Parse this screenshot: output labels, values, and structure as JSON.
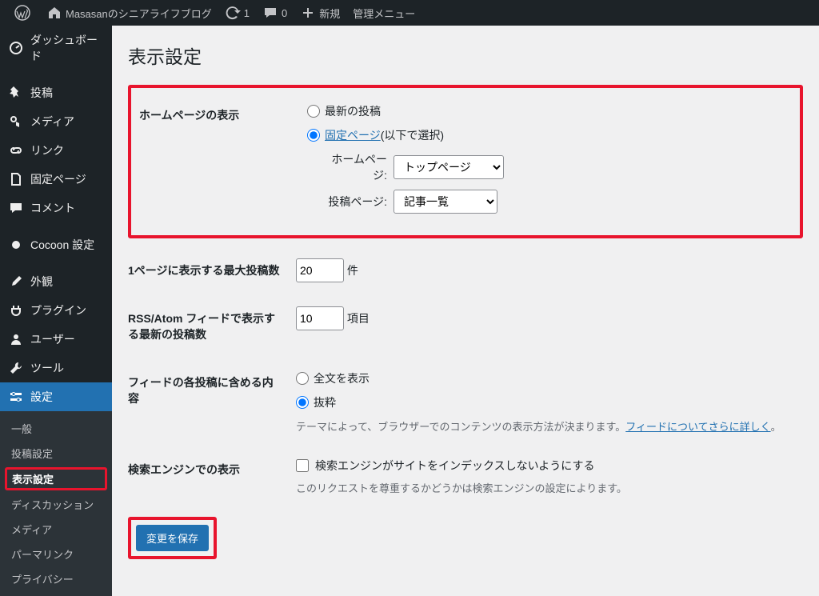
{
  "toolbar": {
    "site_name": "Masasanのシニアライフブログ",
    "updates": "1",
    "comments": "0",
    "new": "新規",
    "admin_menu": "管理メニュー"
  },
  "sidebar": {
    "items": [
      {
        "label": "ダッシュボード",
        "icon": "dashboard"
      },
      {
        "label": "投稿",
        "icon": "pin"
      },
      {
        "label": "メディア",
        "icon": "media"
      },
      {
        "label": "リンク",
        "icon": "link"
      },
      {
        "label": "固定ページ",
        "icon": "page"
      },
      {
        "label": "コメント",
        "icon": "comment"
      },
      {
        "label": "Cocoon 設定",
        "icon": "cocoon"
      },
      {
        "label": "外観",
        "icon": "brush"
      },
      {
        "label": "プラグイン",
        "icon": "plug"
      },
      {
        "label": "ユーザー",
        "icon": "user"
      },
      {
        "label": "ツール",
        "icon": "tool"
      },
      {
        "label": "設定",
        "icon": "settings"
      }
    ],
    "submenu": [
      {
        "label": "一般"
      },
      {
        "label": "投稿設定"
      },
      {
        "label": "表示設定",
        "active": true
      },
      {
        "label": "ディスカッション"
      },
      {
        "label": "メディア"
      },
      {
        "label": "パーマリンク"
      },
      {
        "label": "プライバシー"
      }
    ]
  },
  "page": {
    "title": "表示設定",
    "homepage": {
      "label": "ホームページの表示",
      "opt_latest": "最新の投稿",
      "opt_fixed_link": "固定ページ",
      "opt_fixed_suffix": " (以下で選択)",
      "home_label": "ホームページ:",
      "home_value": "トップページ",
      "posts_label": "投稿ページ:",
      "posts_value": "記事一覧"
    },
    "per_page": {
      "label": "1ページに表示する最大投稿数",
      "value": "20",
      "unit": "件"
    },
    "rss": {
      "label": "RSS/Atom フィードで表示する最新の投稿数",
      "value": "10",
      "unit": "項目"
    },
    "feed": {
      "label": "フィードの各投稿に含める内容",
      "opt_full": "全文を表示",
      "opt_excerpt": "抜粋",
      "note_prefix": "テーマによって、ブラウザーでのコンテンツの表示方法が決まります。",
      "note_link": "フィードについてさらに詳しく",
      "note_suffix": "。"
    },
    "search": {
      "label": "検索エンジンでの表示",
      "chk": "検索エンジンがサイトをインデックスしないようにする",
      "note": "このリクエストを尊重するかどうかは検索エンジンの設定によります。"
    },
    "submit": "変更を保存"
  }
}
